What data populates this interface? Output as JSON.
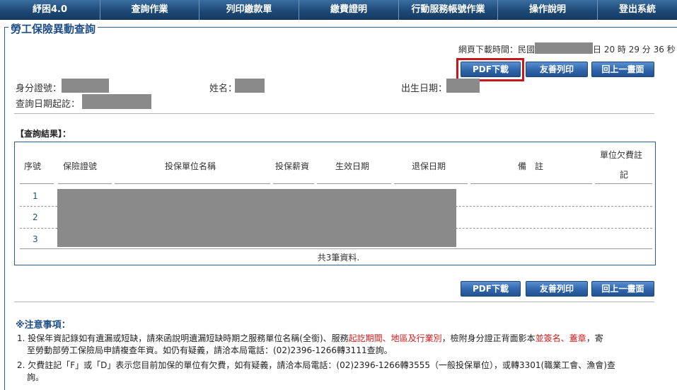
{
  "nav": {
    "items": [
      "紓困4.0",
      "查詢作業",
      "列印繳款單",
      "繳費證明",
      "行動服務帳號作業",
      "操作說明",
      "登出系統"
    ]
  },
  "page": {
    "title": "勞工保險異動查詢",
    "download_time_label": "網頁下載時間：民國",
    "download_time_tail": "日 20 時 29 分 36 秒"
  },
  "buttons": {
    "pdf": "PDF下載",
    "print": "友善列印",
    "back": "回上一畫面"
  },
  "info": {
    "id_label": "身分證號：",
    "name_label": "姓名：",
    "birth_label": "出生日期：",
    "query_date_label": "查詢日期起訖："
  },
  "results": {
    "label": "【查詢結果】：",
    "columns": [
      "序號",
      "保險證號",
      "投保單位名稱",
      "投保薪資",
      "生效日期",
      "退保日期",
      "備　註",
      "單位欠費註",
      "記"
    ],
    "rows": [
      "1",
      "2",
      "3"
    ],
    "total": "共3筆資料."
  },
  "notes": {
    "title": "※注意事項：",
    "n1_a": "1. 投保年資記錄如有遺漏或短缺，請來函說明遺漏短缺時期之服務單位名稱(全銜)、服務",
    "n1_red1": "起訖期間、地區及行業別",
    "n1_b": "，檢附身分證正背面影本",
    "n1_red2": "並簽名、蓋章",
    "n1_c": "，寄",
    "n1_d": "至勞動部勞工保險局申請複查年資。如仍有疑義，請洽本局電話：(02)2396-1266轉3111查詢。",
    "n2_a": "2. 欠費註記「F」或「D」表示您目前加保的單位有欠費，如有疑義，請洽本局電話：(02)2396-1266轉3555（一般投保單位），或轉3301(職業工會、漁會)查",
    "n2_b": "詢。"
  },
  "colors": {
    "nav_bg": "#1e4a78",
    "accent": "#1f4f86",
    "highlight": "#c8161d",
    "warning_text": "#d21a1a"
  }
}
